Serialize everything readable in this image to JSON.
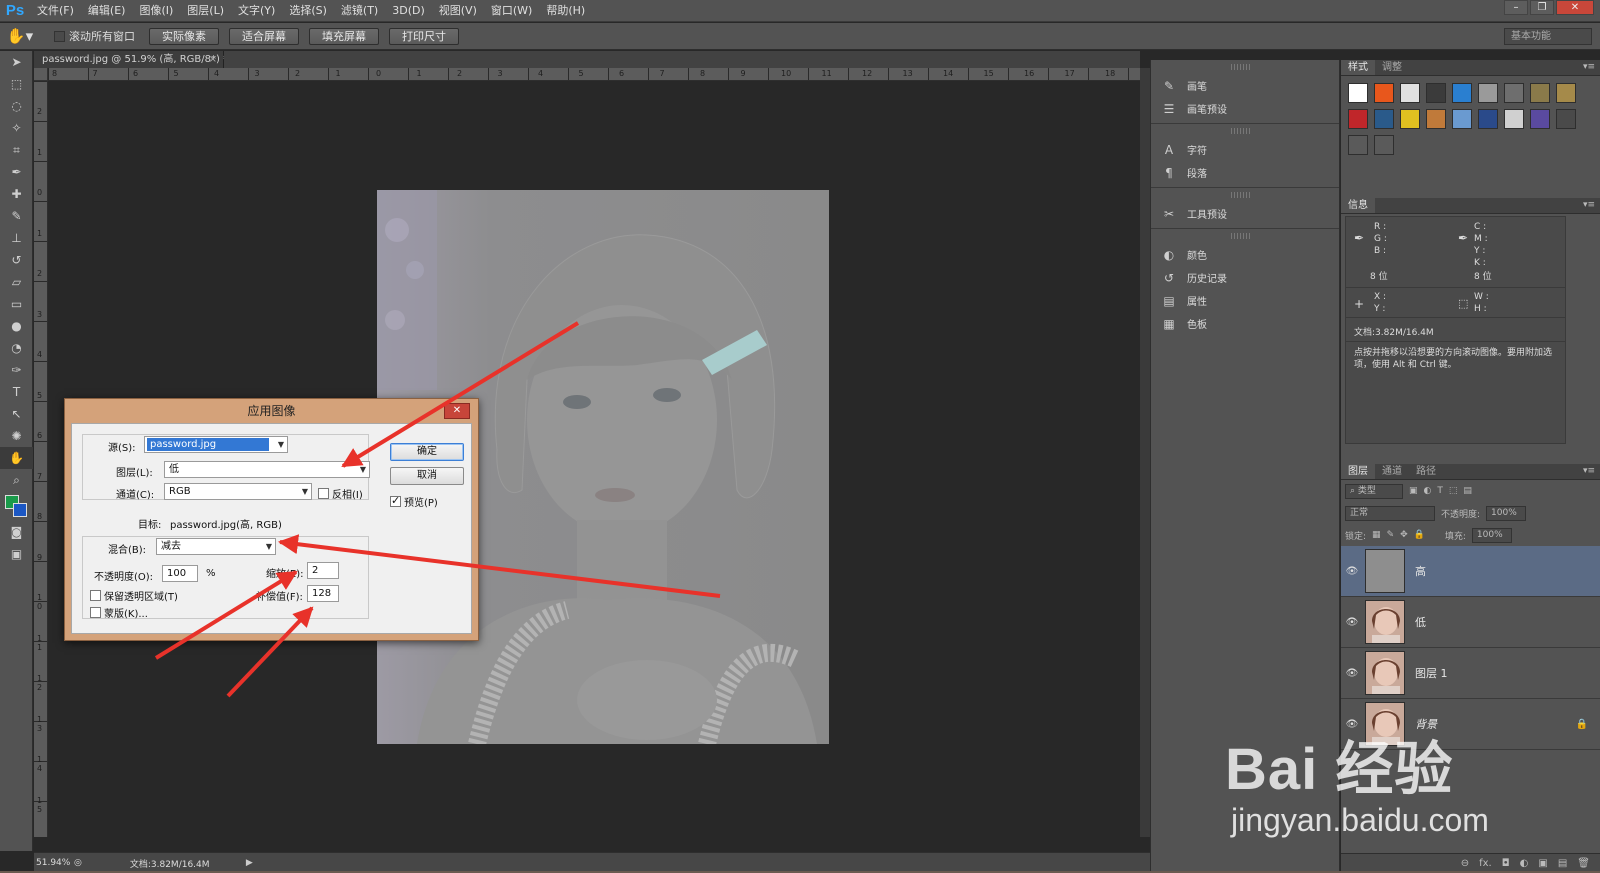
{
  "app": {
    "logo": "Ps"
  },
  "menu": [
    "文件(F)",
    "编辑(E)",
    "图像(I)",
    "图层(L)",
    "文字(Y)",
    "选择(S)",
    "滤镜(T)",
    "3D(D)",
    "视图(V)",
    "窗口(W)",
    "帮助(H)"
  ],
  "window_controls": {
    "minimize": "–",
    "restore": "❐",
    "close": "✕"
  },
  "options": {
    "scroll_all_label": "滚动所有窗口",
    "buttons": [
      "实际像素",
      "适合屏幕",
      "填充屏幕",
      "打印尺寸"
    ],
    "workspace": "基本功能"
  },
  "document": {
    "tab_title": "password.jpg @ 51.9% (高, RGB/8*) *",
    "tab_close": "×",
    "ruler_h": [
      "8",
      "7",
      "6",
      "5",
      "4",
      "3",
      "2",
      "1",
      "0",
      "1",
      "2",
      "3",
      "4",
      "5",
      "6",
      "7",
      "8",
      "9",
      "10",
      "11",
      "12",
      "13",
      "14",
      "15",
      "16",
      "17",
      "18"
    ],
    "ruler_v": [
      "2",
      "1",
      "0",
      "1",
      "2",
      "3",
      "4",
      "5",
      "6",
      "7",
      "8",
      "9",
      "1 0",
      "1 1",
      "1 2",
      "1 3",
      "1 4",
      "1 5"
    ]
  },
  "status": {
    "zoom": "51.94%",
    "doc_info": "文档:3.82M/16.4M",
    "arrow": "▶"
  },
  "mid_panels": [
    {
      "icon": "brush-icon",
      "glyph": "✎",
      "label": "画笔"
    },
    {
      "icon": "brush-presets-icon",
      "glyph": "☰",
      "label": "画笔预设"
    },
    {
      "icon": "character-icon",
      "glyph": "A",
      "label": "字符"
    },
    {
      "icon": "paragraph-icon",
      "glyph": "¶",
      "label": "段落"
    },
    {
      "icon": "tool-presets-icon",
      "glyph": "✂",
      "label": "工具预设"
    },
    {
      "icon": "color-icon",
      "glyph": "◐",
      "label": "颜色"
    },
    {
      "icon": "history-icon",
      "glyph": "↺",
      "label": "历史记录"
    },
    {
      "icon": "properties-icon",
      "glyph": "▤",
      "label": "属性"
    },
    {
      "icon": "swatches-icon",
      "glyph": "▦",
      "label": "色板"
    }
  ],
  "styles_panel": {
    "tabs": [
      "样式",
      "调整"
    ],
    "swatches": [
      "#ffffff",
      "#e8571c",
      "#e0e0e0",
      "#3b3b3b",
      "#2a7fd0",
      "#9a9a9a",
      "#6e6e6e",
      "#8a7a4a",
      "#a58a4a",
      "#c0262a",
      "#2a5a8a",
      "#e0c020",
      "#c07a3a",
      "#6a9ad0",
      "#2a4a8a",
      "#d0d0d0",
      "#5a4aa0",
      "#4a4a4a",
      "#5a5a5a",
      "#5a5a5a"
    ]
  },
  "info_panel": {
    "tab": "信息",
    "rgb": "R :\nG :\nB :",
    "cmyk": "C :\nM :\nY :\nK :",
    "bits_left": "8 位",
    "bits_right": "8 位",
    "xy": "X :\nY :",
    "wh": "W :\nH :",
    "doc": "文档:3.82M/16.4M",
    "hint": "点按并拖移以沿想要的方向滚动图像。要用附加选项，使用 Alt 和 Ctrl 键。"
  },
  "layers_panel": {
    "tabs": [
      "图层",
      "通道",
      "路径"
    ],
    "filter": "类型",
    "blend_mode": "正常",
    "opacity_label": "不透明度:",
    "opacity": "100%",
    "lock_label": "锁定:",
    "fill_label": "填充:",
    "fill": "100%",
    "layers": [
      {
        "name": "高",
        "active": true,
        "italic": false,
        "lock": false
      },
      {
        "name": "低",
        "active": false,
        "italic": false,
        "lock": false
      },
      {
        "name": "图层 1",
        "active": false,
        "italic": false,
        "lock": false
      },
      {
        "name": "背景",
        "active": false,
        "italic": true,
        "lock": true
      }
    ],
    "footer": [
      "⊖",
      "fx.",
      "◘",
      "◐",
      "▣",
      "▤",
      "🗑"
    ]
  },
  "dialog": {
    "title": "应用图像",
    "close": "✕",
    "source_label": "源(S):",
    "source_value": "password.jpg",
    "layer_label": "图层(L):",
    "layer_value": "低",
    "channel_label": "通道(C):",
    "channel_value": "RGB",
    "invert_label": "反相(I)",
    "target_label": "目标:",
    "target_value": "password.jpg(高, RGB)",
    "blending_label": "混合(B):",
    "blending_value": "减去",
    "opacity_label": "不透明度(O):",
    "opacity_value": "100",
    "percent": "%",
    "scale_label": "缩放(E):",
    "scale_value": "2",
    "offset_label": "补偿值(F):",
    "offset_value": "128",
    "preserve_label": "保留透明区域(T)",
    "mask_label": "蒙版(K)...",
    "ok_label": "确定",
    "cancel_label": "取消",
    "preview_label": "预览(P)",
    "preview_checked": true
  },
  "watermark": {
    "main": "Bai 经验",
    "sub": "jingyan.baidu.com"
  }
}
